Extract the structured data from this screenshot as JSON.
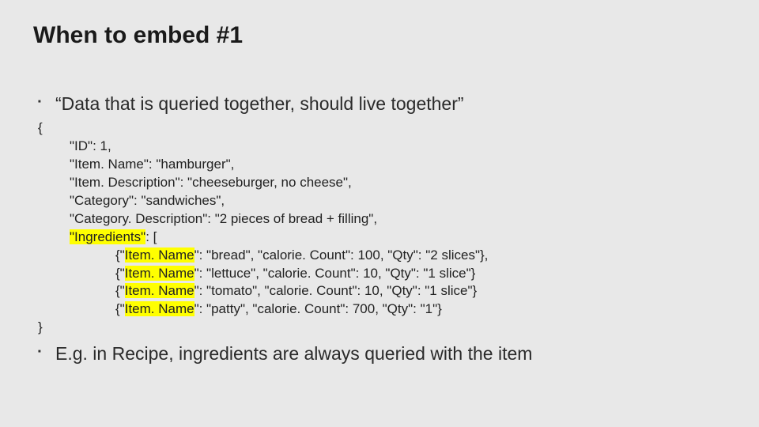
{
  "title": "When to embed #1",
  "bullet1": "“Data that is queried together, should live together”",
  "bullet2": "E.g. in Recipe, ingredients are always queried with the item",
  "code": {
    "open": "{",
    "id_key": "\"ID\": ",
    "id_val": "1,",
    "name": "\"Item. Name\": \"hamburger\",",
    "desc": "\"Item. Description\": \"cheeseburger, no cheese\",",
    "cat": "\"Category\": \"sandwiches\",",
    "catdesc": "\"Category. Description\": \"2 pieces of bread + filling\",",
    "ingredients_key": "\"Ingredients\"",
    "ingredients_after": ": [",
    "ing_open": "{\"",
    "ing_name": "Item. Name",
    "ing1_rest": "\": \"bread\", \"calorie. Count\": 100, \"Qty\": \"2 slices\"},",
    "ing2_rest": "\": \"lettuce\", \"calorie. Count\": 10, \"Qty\": \"1 slice\"}",
    "ing3_rest": "\": \"tomato\", \"calorie. Count\": 10, \"Qty\": \"1 slice\"}",
    "ing4_rest": "\": \"patty\", \"calorie. Count\": 700, \"Qty\": \"1\"}",
    "close": "}"
  }
}
